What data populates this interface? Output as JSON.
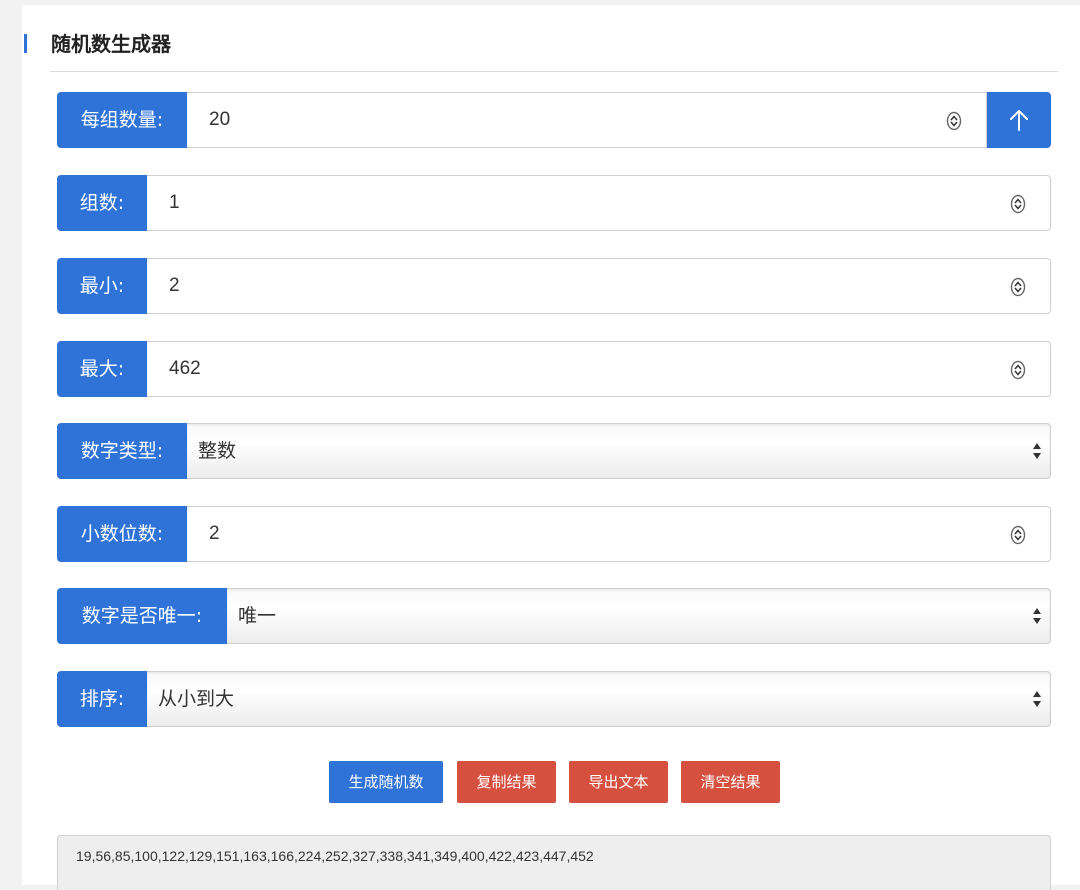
{
  "title": "随机数生成器",
  "colors": {
    "accent": "#2f73d8",
    "danger": "#d65040"
  },
  "fields": {
    "per_group": {
      "label": "每组数量:",
      "value": "20"
    },
    "groups": {
      "label": "组数:",
      "value": "1"
    },
    "min": {
      "label": "最小:",
      "value": "2"
    },
    "max": {
      "label": "最大:",
      "value": "462"
    },
    "number_type": {
      "label": "数字类型:",
      "value": "整数"
    },
    "decimals": {
      "label": "小数位数:",
      "value": "2"
    },
    "unique": {
      "label": "数字是否唯一:",
      "value": "唯一"
    },
    "sort": {
      "label": "排序:",
      "value": "从小到大"
    }
  },
  "icons": {
    "collapse": "arrow-up-icon",
    "spinner": "spinner-icon",
    "select": "select-arrows-icon"
  },
  "buttons": {
    "generate": "生成随机数",
    "copy": "复制结果",
    "export": "导出文本",
    "clear": "清空结果"
  },
  "result": "19,56,85,100,122,129,151,163,166,224,252,327,338,341,349,400,422,423,447,452"
}
